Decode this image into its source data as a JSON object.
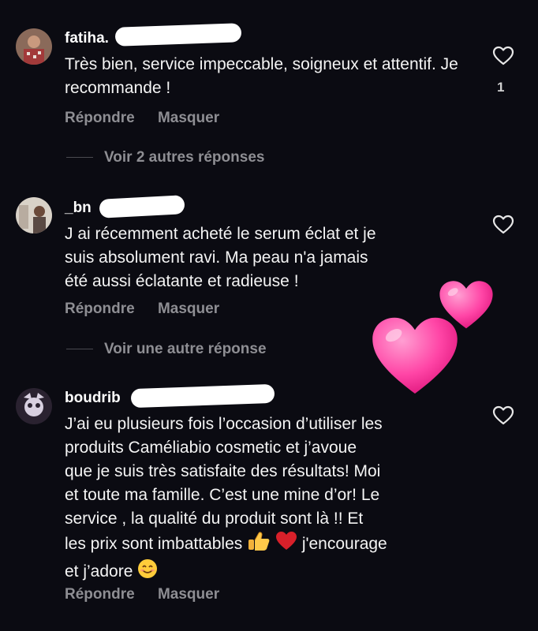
{
  "comments": [
    {
      "username": "fatiha.",
      "text": "Très bien, service impeccable, soigneux et attentif.  Je recommande !",
      "reply_label": "Répondre",
      "hide_label": "Masquer",
      "likes": "1",
      "more_replies": "Voir 2 autres réponses"
    },
    {
      "username": "_bn",
      "text_lines": [
        "J ai récemment acheté le serum éclat et je",
        "suis absolument ravi. Ma peau n'a jamais",
        "été aussi éclatante et radieuse !"
      ],
      "reply_label": "Répondre",
      "hide_label": "Masquer",
      "more_replies": "Voir une autre réponse"
    },
    {
      "username": "boudrib",
      "text_lines": [
        "J’ai eu plusieurs fois l’occasion d’utiliser les",
        "produits Caméliabio cosmetic et j’avoue",
        "que je suis très satisfaite des résultats! Moi",
        "et toute ma famille. C’est une mine d’or! Le",
        "service , la qualité du produit sont là !! Et",
        "les prix sont imbattables",
        "j'encourage",
        "et j’adore"
      ],
      "reply_label": "Répondre",
      "hide_label": "Masquer",
      "emojis": [
        "thumbs-up",
        "red-heart",
        "smiling-face"
      ]
    }
  ],
  "colors": {
    "background": "#0b0b12",
    "secondary_text": "#8e8e93",
    "sticker_pink": "#ff4fa8"
  },
  "icons": [
    "heart-outline-icon",
    "pink-heart-sticker"
  ]
}
